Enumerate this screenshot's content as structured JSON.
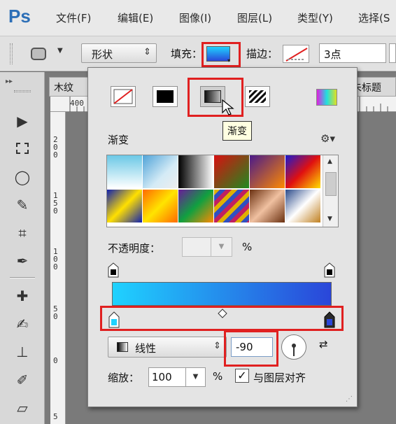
{
  "app": {
    "logo": "Ps"
  },
  "menu": [
    {
      "label": "文件(F)"
    },
    {
      "label": "编辑(E)"
    },
    {
      "label": "图像(I)"
    },
    {
      "label": "图层(L)"
    },
    {
      "label": "类型(Y)"
    },
    {
      "label": "选择(S"
    }
  ],
  "options": {
    "mode_value": "形状",
    "fill_label": "填充：",
    "stroke_label": "描边：",
    "stroke_width": "3点"
  },
  "document": {
    "tab_left": "木纹",
    "tab_right": "未标题",
    "ruler_top_mark": "400",
    "ruler_left_marks": [
      "200",
      "150",
      "100",
      "50",
      "0",
      "5"
    ]
  },
  "panel": {
    "tooltip": "渐变",
    "gradient_heading": "渐变",
    "opacity_label": "不透明度：",
    "opacity_unit": "%",
    "style_value": "线性",
    "angle_value": "-90",
    "scale_label": "缩放：",
    "scale_value": "100",
    "scale_unit": "%",
    "align_label": "与图层对齐",
    "align_checked": true,
    "gradient_colors": [
      "#1fd2ff",
      "#2a46d9"
    ],
    "highlight_color": "#e02020"
  },
  "presets": [
    {
      "name": "blue-white",
      "css": "linear-gradient(180deg,#6bc8e6,#ffffff)"
    },
    {
      "name": "transparent-checker",
      "css": "linear-gradient(135deg,#4fa3d8,#d4ebf6 60%,#eeeeee)"
    },
    {
      "name": "black-white",
      "css": "linear-gradient(90deg,#000,#ffffff)"
    },
    {
      "name": "red-green",
      "css": "linear-gradient(135deg,#d81010,#1f8a1f)"
    },
    {
      "name": "violet-orange",
      "css": "linear-gradient(135deg,#4a1a8a,#ff8a00)"
    },
    {
      "name": "blue-red-yellow",
      "css": "linear-gradient(135deg,#1a1ad0,#e01010 50%,#ffe000)"
    },
    {
      "name": "blue-yellow-blue",
      "css": "linear-gradient(135deg,#1020b0,#ffe000 50%,#1020b0)"
    },
    {
      "name": "orange-yellow-orange",
      "css": "linear-gradient(135deg,#ff6a00,#ffe400 50%,#ff6a00)"
    },
    {
      "name": "violet-green-orange",
      "css": "linear-gradient(135deg,#6a1a9a,#10a040 50%,#ff8a00)"
    },
    {
      "name": "transparent-stripes",
      "css": "repeating-linear-gradient(135deg,#e0b000 0 6px,#3050c0 6px 12px,#c02060 12px 18px)"
    },
    {
      "name": "copper",
      "css": "linear-gradient(135deg,#6a3010,#f0c0a0 50%,#6a3010)"
    },
    {
      "name": "chrome",
      "css": "linear-gradient(135deg,#2a4a8a,#ffffff 50%,#c08020)"
    }
  ]
}
